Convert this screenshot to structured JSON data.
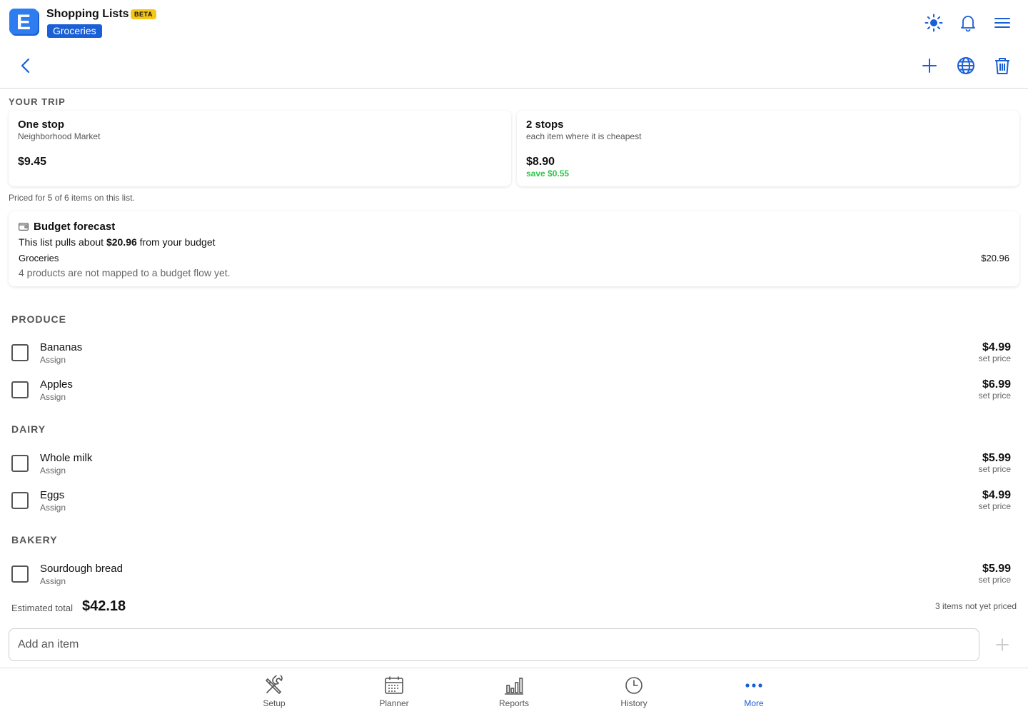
{
  "header": {
    "app_title": "Shopping Lists",
    "beta_label": "BETA",
    "list_name": "Groceries",
    "logo_letter": "E",
    "icons": [
      "sun-icon",
      "bell-icon",
      "menu-icon"
    ]
  },
  "toolbar": {
    "icons": [
      "back-chevron-icon",
      "plus-icon",
      "globe-icon",
      "trash-icon"
    ]
  },
  "trip": {
    "caption": "YOUR TRIP",
    "one_stop": {
      "title": "One stop",
      "subtitle": "Neighborhood Market",
      "price": "$9.45"
    },
    "two_stops": {
      "title": "2 stops",
      "subtitle": "each item where it is cheapest",
      "price": "$8.90",
      "save": "save $0.55"
    },
    "priced_note": "Priced for 5 of 6 items on this list."
  },
  "budget": {
    "title": "Budget forecast",
    "line_prefix": "This list pulls about ",
    "line_amount": "$20.96",
    "line_suffix": " from your budget",
    "category": "Groceries",
    "category_amount": "$20.96",
    "unmapped_note": "4 products are not mapped to a budget flow yet."
  },
  "categories": [
    {
      "name": "PRODUCE",
      "items": [
        {
          "name": "Bananas",
          "assign": "Assign",
          "price": "$4.99",
          "set_price": "set price",
          "checked": false
        },
        {
          "name": "Apples",
          "assign": "Assign",
          "price": "$6.99",
          "set_price": "set price",
          "checked": false
        }
      ]
    },
    {
      "name": "DAIRY",
      "items": [
        {
          "name": "Whole milk",
          "assign": "Assign",
          "price": "$5.99",
          "set_price": "set price",
          "checked": false
        },
        {
          "name": "Eggs",
          "assign": "Assign",
          "price": "$4.99",
          "set_price": "set price",
          "checked": false
        }
      ]
    },
    {
      "name": "BAKERY",
      "items": [
        {
          "name": "Sourdough bread",
          "assign": "Assign",
          "price": "$5.99",
          "set_price": "set price",
          "checked": false
        }
      ]
    }
  ],
  "totals": {
    "label": "Estimated total",
    "value": "$42.18",
    "not_priced": "3 items not yet priced"
  },
  "add_item": {
    "placeholder": "Add an item"
  },
  "bottom_nav": [
    {
      "label": "Setup",
      "icon": "tools-icon",
      "active": false
    },
    {
      "label": "Planner",
      "icon": "calendar-icon",
      "active": false
    },
    {
      "label": "Reports",
      "icon": "bar-chart-icon",
      "active": false
    },
    {
      "label": "History",
      "icon": "clock-icon",
      "active": false
    },
    {
      "label": "More",
      "icon": "more-dots-icon",
      "active": true
    }
  ],
  "colors": {
    "accent": "#1a5fd6",
    "beta": "#f5c518",
    "save": "#2ec64a"
  }
}
